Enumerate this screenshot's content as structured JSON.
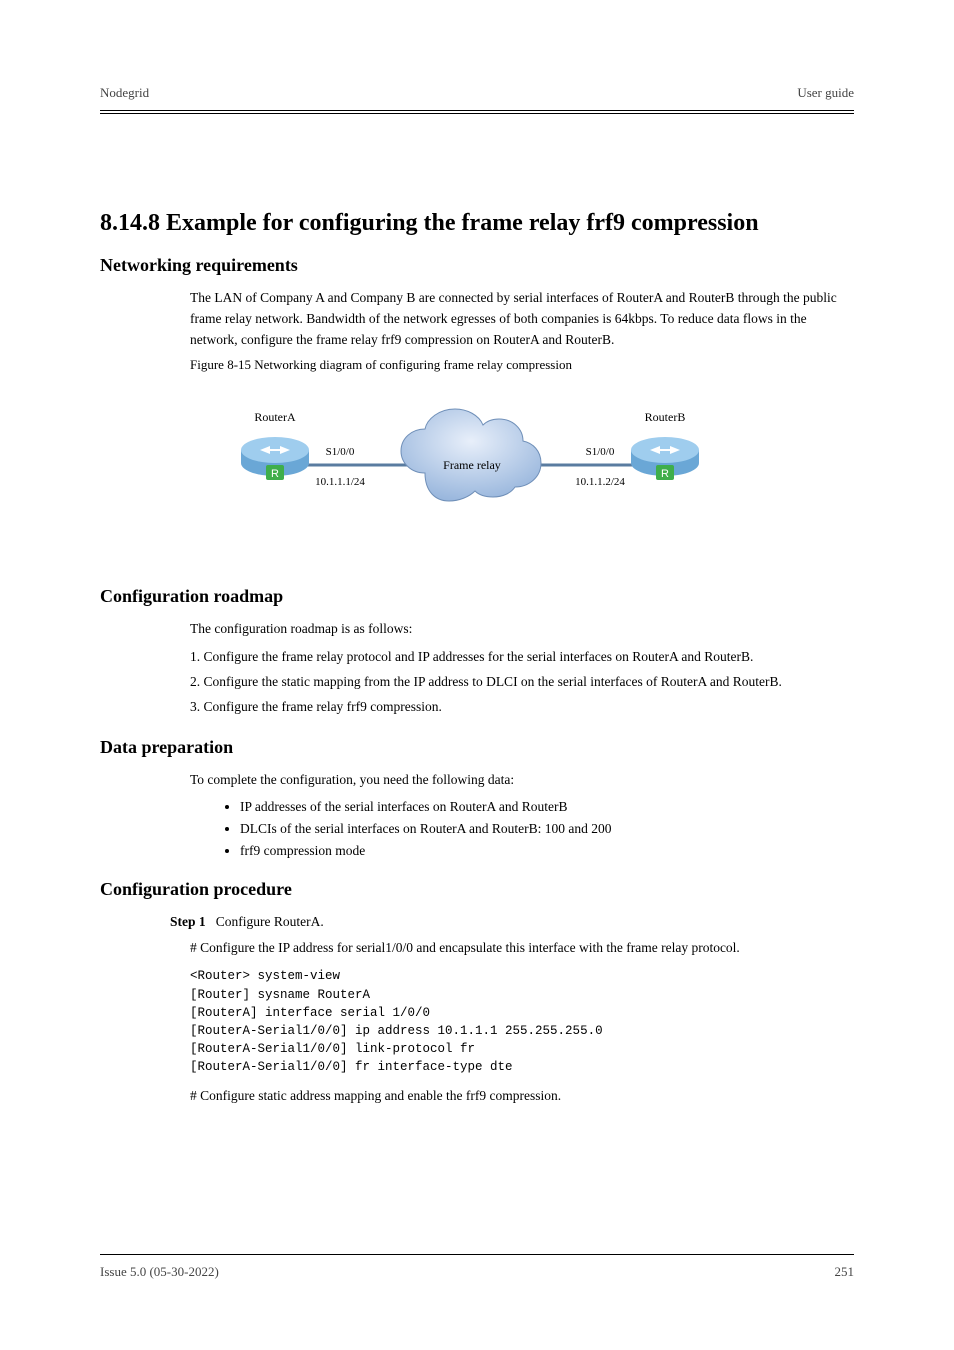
{
  "header": {
    "left": "Nodegrid",
    "right": "User guide"
  },
  "section": {
    "number": "8.14.8",
    "title": "Example for configuring the frame relay frf9 compression"
  },
  "netreq": {
    "heading": "Networking requirements",
    "para": "The LAN of Company A and Company B are connected by serial interfaces of RouterA and RouterB through the public frame relay network. Bandwidth of the network egresses of both companies is 64kbps. To reduce data flows in the network, configure the frame relay frf9 compression on RouterA and RouterB.",
    "fig_label": "Figure 8-15 Networking diagram of configuring frame relay compression",
    "labelA": "RouterA",
    "labelB": "RouterB",
    "cloud": "Frame relay",
    "ifA": "S1/0/0",
    "ifB": "S1/0/0",
    "ipA": "10.1.1.1/24",
    "ipB": "10.1.1.2/24"
  },
  "roadmap": {
    "heading": "Configuration roadmap",
    "intro": "The configuration roadmap is as follows:",
    "items": [
      "1.  Configure the frame relay protocol and IP addresses for the serial interfaces on RouterA and RouterB.",
      "2.  Configure the static mapping from the IP address to DLCI on the serial interfaces of RouterA and RouterB.",
      "3.  Configure the frame relay frf9 compression."
    ]
  },
  "dataprep": {
    "heading": "Data preparation",
    "intro": "To complete the configuration, you need the following data:",
    "items": [
      "IP addresses of the serial interfaces on RouterA and RouterB",
      "DLCIs of the serial interfaces on RouterA and RouterB: 100 and 200",
      "frf9 compression mode"
    ]
  },
  "procedure": {
    "heading": "Configuration procedure",
    "step_label": "Step 1",
    "step_text": "Configure RouterA.",
    "comment1": "# Configure the IP address for serial1/0/0 and encapsulate this interface with the frame relay protocol.",
    "cli": "<Router> system-view\n[Router] sysname RouterA\n[RouterA] interface serial 1/0/0\n[RouterA-Serial1/0/0] ip address 10.1.1.1 255.255.255.0\n[RouterA-Serial1/0/0] link-protocol fr\n[RouterA-Serial1/0/0] fr interface-type dte",
    "comment2": "# Configure static address mapping and enable the frf9 compression."
  },
  "footer": {
    "left": "Issue 5.0 (05-30-2022)",
    "right": "251"
  }
}
